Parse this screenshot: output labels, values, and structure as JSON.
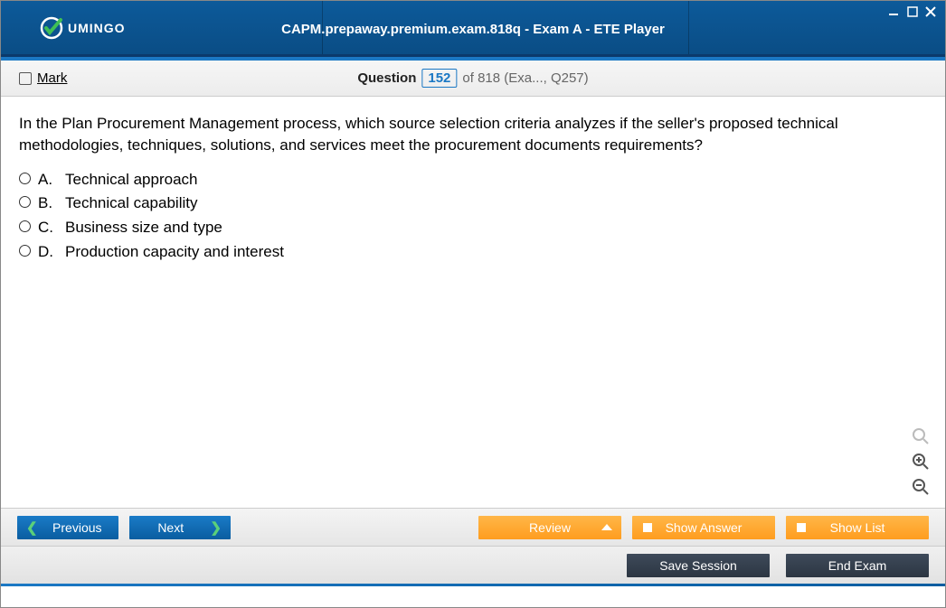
{
  "header": {
    "brand": "UMINGO",
    "title": "CAPM.prepaway.premium.exam.818q - Exam A - ETE Player"
  },
  "toolbar": {
    "mark_label": "Mark",
    "question_label": "Question",
    "question_number": "152",
    "of_text": "of 818 (Exa..., Q257)"
  },
  "question": {
    "text": "In the Plan Procurement Management process, which source selection criteria analyzes if the seller's proposed technical methodologies, techniques, solutions, and services meet the procurement documents requirements?",
    "options": [
      {
        "letter": "A.",
        "text": "Technical approach"
      },
      {
        "letter": "B.",
        "text": "Technical capability"
      },
      {
        "letter": "C.",
        "text": "Business size and type"
      },
      {
        "letter": "D.",
        "text": "Production capacity and interest"
      }
    ]
  },
  "footer": {
    "previous": "Previous",
    "next": "Next",
    "review": "Review",
    "show_answer": "Show Answer",
    "show_list": "Show List",
    "save_session": "Save Session",
    "end_exam": "End Exam"
  }
}
